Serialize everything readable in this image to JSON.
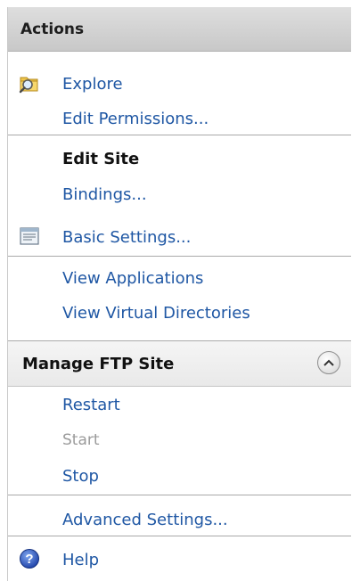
{
  "actions": {
    "title": "Actions",
    "site_links": [
      {
        "label": "Explore",
        "icon": "explore-folder-icon",
        "enabled": true
      },
      {
        "label": "Edit Permissions...",
        "icon": null,
        "enabled": true
      }
    ],
    "edit_site": {
      "title": "Edit Site",
      "items": [
        {
          "label": "Bindings...",
          "icon": null,
          "enabled": true
        },
        {
          "label": "Basic Settings...",
          "icon": "settings-window-icon",
          "enabled": true
        }
      ]
    },
    "view_links": [
      {
        "label": "View Applications",
        "enabled": true
      },
      {
        "label": "View Virtual Directories",
        "enabled": true
      }
    ],
    "manage_ftp": {
      "title": "Manage FTP Site",
      "collapse_icon": "chevron-up-icon",
      "items": [
        {
          "label": "Restart",
          "enabled": true
        },
        {
          "label": "Start",
          "enabled": false
        },
        {
          "label": "Stop",
          "enabled": true
        }
      ],
      "advanced": {
        "label": "Advanced Settings...",
        "enabled": true
      }
    },
    "help": {
      "label": "Help",
      "icon": "help-icon",
      "enabled": true
    }
  }
}
